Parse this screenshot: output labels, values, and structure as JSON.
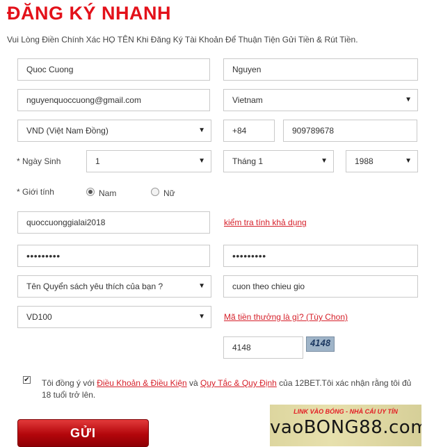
{
  "header": {
    "title": "ĐĂNG KÝ NHANH",
    "subtitle": "Vui Lòng Điền Chính Xác HỌ TÊN Khi Đăng Ký Tài Khoản Để Thuận Tiện Gửi Tiền & Rút Tiền."
  },
  "form": {
    "first_name": "Quoc Cuong",
    "last_name": "Nguyen",
    "email": "nguyenquoccuong@gmail.com",
    "country": "Vietnam",
    "currency": "VND (Việt Nam Đồng)",
    "phone_code": "+84",
    "phone": "909789678",
    "dob_label": "* Ngày Sinh",
    "dob_day": "1",
    "dob_month": "Tháng 1",
    "dob_year": "1988",
    "gender_label": "* Giới tính",
    "gender_male": "Nam",
    "gender_female": "Nữ",
    "gender_selected": "Nam",
    "username": "quoccuonggialai2018",
    "check_availability": "kiểm tra tính khả dụng",
    "password": "•••••••••",
    "password_confirm": "•••••••••",
    "security_question": "Tên Quyển sách yêu thích của bạn ?",
    "security_answer": "cuon theo chieu gio",
    "bonus_code": "VD100",
    "bonus_link": "Mã tiền thưởng là gì? (Tùy Chon)",
    "captcha_input": "4148",
    "captcha_image_text": "4148",
    "dropdown_icon": "▼"
  },
  "agreement": {
    "checked": true,
    "check_mark": "✔",
    "text_1": "Tôi đồng ý với ",
    "terms_link": "Điều Khoản & Điều Kiện",
    "text_2": " và ",
    "rules_link": "Quy Tắc & Quy Định",
    "text_3": " của 12BET.Tôi xác nhận rằng tôi đủ 18 tuổi trở lên."
  },
  "submit": {
    "label": "GỬI"
  },
  "banner": {
    "tagline": "LINK VÀO BÓNG - NHÀ CÁI UY TÍN",
    "brand": "vaoBONG88.com"
  },
  "colors": {
    "accent": "#e3111a",
    "link": "#d6202a",
    "button": "#b3060b"
  }
}
